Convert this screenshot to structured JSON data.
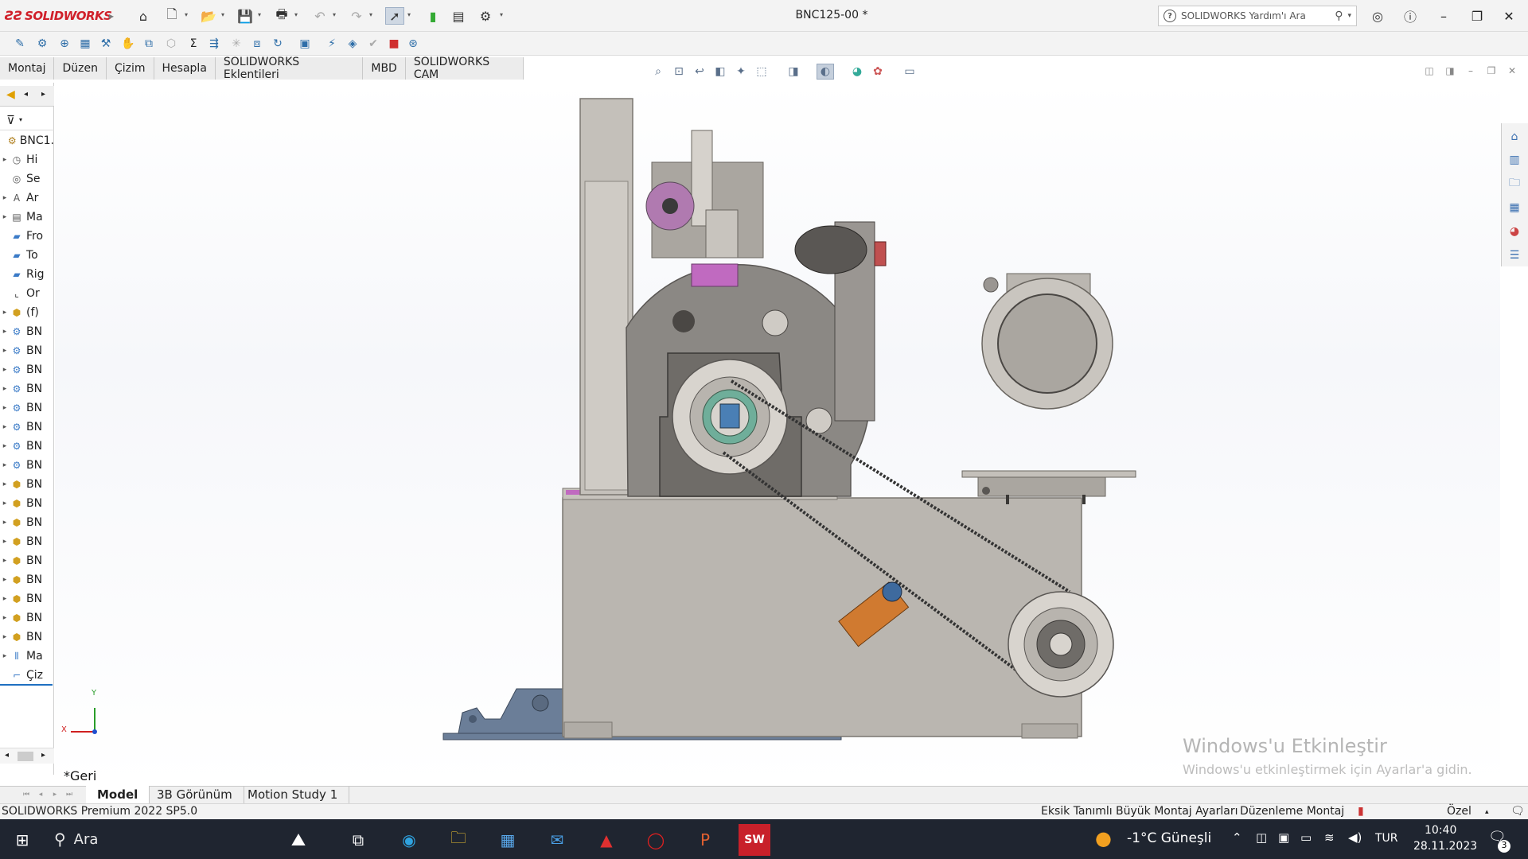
{
  "app": {
    "brand": "SOLIDWORKS",
    "doc_title": "BNC125-00 *"
  },
  "help_search": {
    "placeholder": "SOLIDWORKS Yardım'ı Ara"
  },
  "window_controls": {
    "minimize": "–",
    "restore": "❐",
    "close": "✕"
  },
  "command_tabs": [
    "Montaj",
    "Düzen",
    "Çizim",
    "Hesapla",
    "SOLIDWORKS Eklentileri",
    "MBD",
    "SOLIDWORKS CAM"
  ],
  "tree": [
    {
      "label": "BNC1.",
      "icon": "assembly-icon",
      "arrow": ""
    },
    {
      "label": "Hi",
      "icon": "history-icon",
      "arrow": "▸"
    },
    {
      "label": "Se",
      "icon": "sensor-icon",
      "arrow": ""
    },
    {
      "label": "Ar",
      "icon": "annotation-icon",
      "arrow": "▸"
    },
    {
      "label": "Ma",
      "icon": "material-icon",
      "arrow": "▸"
    },
    {
      "label": "Fro",
      "icon": "plane-icon",
      "arrow": ""
    },
    {
      "label": "To",
      "icon": "plane-icon",
      "arrow": ""
    },
    {
      "label": "Rig",
      "icon": "plane-icon",
      "arrow": ""
    },
    {
      "label": "Or",
      "icon": "origin-icon",
      "arrow": ""
    },
    {
      "label": "(f)",
      "icon": "part-icon",
      "arrow": "▸"
    },
    {
      "label": "BN",
      "icon": "subassembly-icon",
      "arrow": "▸"
    },
    {
      "label": "BN",
      "icon": "subassembly-icon",
      "arrow": "▸"
    },
    {
      "label": "BN",
      "icon": "subassembly-icon",
      "arrow": "▸"
    },
    {
      "label": "BN",
      "icon": "subassembly-icon",
      "arrow": "▸"
    },
    {
      "label": "BN",
      "icon": "subassembly-icon",
      "arrow": "▸"
    },
    {
      "label": "BN",
      "icon": "subassembly-icon",
      "arrow": "▸"
    },
    {
      "label": "BN",
      "icon": "subassembly-icon",
      "arrow": "▸"
    },
    {
      "label": "BN",
      "icon": "subassembly-icon",
      "arrow": "▸"
    },
    {
      "label": "BN",
      "icon": "part-icon",
      "arrow": "▸"
    },
    {
      "label": "BN",
      "icon": "part-icon",
      "arrow": "▸"
    },
    {
      "label": "BN",
      "icon": "part-icon",
      "arrow": "▸"
    },
    {
      "label": "BN",
      "icon": "part-icon",
      "arrow": "▸"
    },
    {
      "label": "BN",
      "icon": "part-icon",
      "arrow": "▸"
    },
    {
      "label": "BN",
      "icon": "part-icon",
      "arrow": "▸"
    },
    {
      "label": "BN",
      "icon": "part-icon",
      "arrow": "▸"
    },
    {
      "label": "BN",
      "icon": "part-icon",
      "arrow": "▸"
    },
    {
      "label": "BN",
      "icon": "part-icon",
      "arrow": "▸"
    },
    {
      "label": "Ma",
      "icon": "mates-icon",
      "arrow": "▸"
    },
    {
      "label": "Çiz",
      "icon": "sketch-icon",
      "arrow": ""
    }
  ],
  "graphics": {
    "back_label": "*Geri",
    "axis_y": "Y",
    "axis_x": "X"
  },
  "bottom_tabs": [
    "Model",
    "3B Görünüm",
    "Motion Study 1"
  ],
  "status": {
    "version": "SOLIDWORKS Premium 2022 SP5.0",
    "defined": "Eksik Tanımlı",
    "large_assembly": "Büyük Montaj Ayarları",
    "editing": "Düzenleme Montaj",
    "units": "Özel"
  },
  "watermark": {
    "line1": "Windows'u Etkinleştir",
    "line2": "Windows'u etkinleştirmek için Ayarlar'a gidin."
  },
  "taskbar": {
    "search": "Ara",
    "weather": "-1°C Güneşli",
    "lang": "TUR",
    "time": "10:40",
    "date": "28.11.2023",
    "notifications": "3"
  },
  "colors": {
    "machine_gray": "#bebab4",
    "dark_gray": "#6f6c68",
    "accent_purple": "#c060c0",
    "bracket_orange": "#d07a30",
    "base_blue": "#6b7e98"
  }
}
